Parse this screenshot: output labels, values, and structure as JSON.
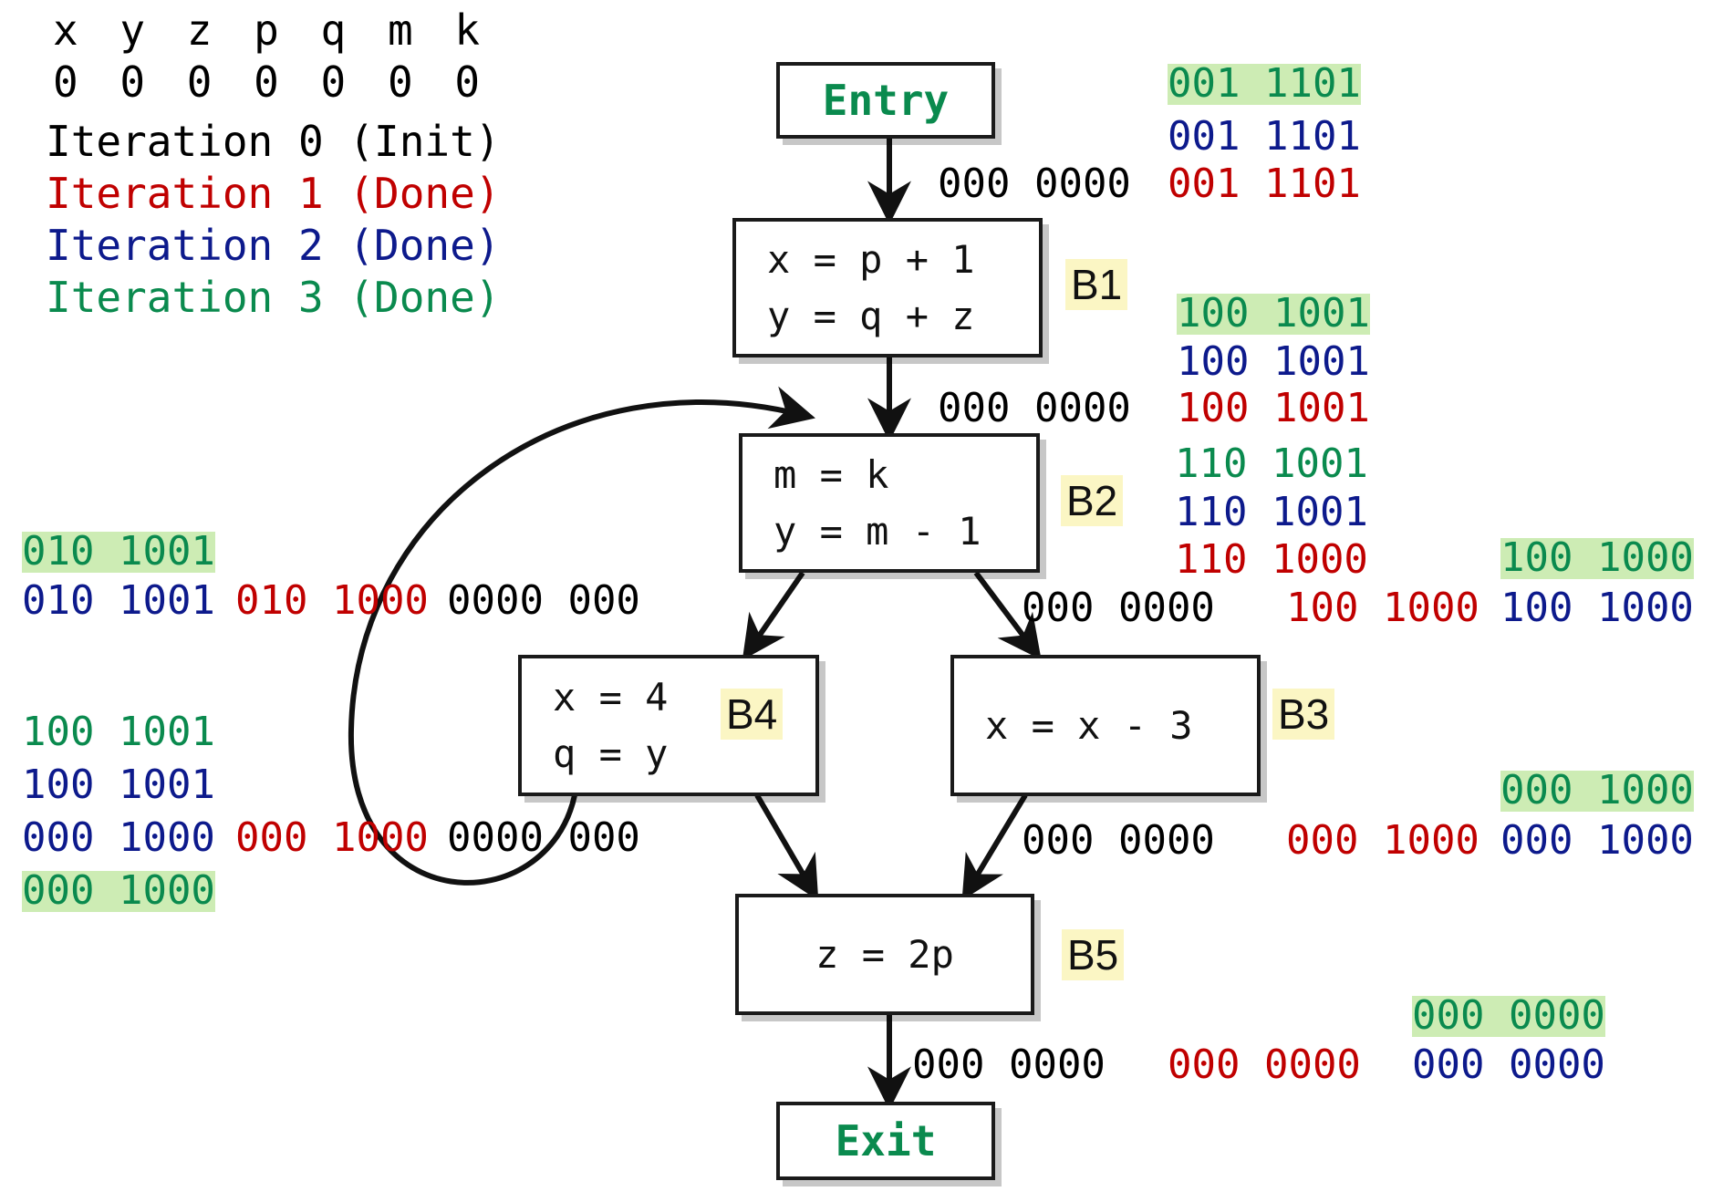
{
  "legend": {
    "variables": "x y z p q m k",
    "initial_bits": "0 0 0 0 0 0 0",
    "iterations": [
      {
        "label": "Iteration 0 (Init)",
        "color": "#000000"
      },
      {
        "label": "Iteration 1 (Done)",
        "color": "#c00000"
      },
      {
        "label": "Iteration 2 (Done)",
        "color": "#0d1a8c"
      },
      {
        "label": "Iteration 3 (Done)",
        "color": "#0a8a4e"
      }
    ]
  },
  "cfg": {
    "entry": {
      "label": "Entry"
    },
    "exit": {
      "label": "Exit"
    },
    "b1": {
      "name": "B1",
      "lines": [
        "x = p + 1",
        "y = q + z"
      ]
    },
    "b2": {
      "name": "B2",
      "lines": [
        "m = k",
        "y = m - 1"
      ]
    },
    "b3": {
      "name": "B3",
      "lines": [
        "x = x - 3"
      ]
    },
    "b4": {
      "name": "B4",
      "lines": [
        "x = 4",
        "q = y"
      ]
    },
    "b5": {
      "name": "B5",
      "lines": [
        "z = 2p"
      ]
    }
  },
  "dataflow": {
    "entry_out": {
      "green": "001 1101",
      "blue": "001 1101",
      "red": "001 1101"
    },
    "b1_in": {
      "black": "000 0000"
    },
    "b1_out": {
      "green": "100 1001",
      "blue": "100 1001",
      "red": "100 1001"
    },
    "b2_in": {
      "black": "000 0000"
    },
    "b2_out": {
      "green": "110 1001",
      "blue": "110 1001",
      "red": "110 1000"
    },
    "b4_in_left": {
      "green": "010 1001",
      "blue": "010 1001",
      "red": "010 1000",
      "black": "0000 000"
    },
    "b4_out_left": {
      "green_top": "100 1001",
      "blue_top": "100 1001",
      "blue": "000 1000",
      "red": "000 1000",
      "black": "0000 000",
      "green": "000 1000"
    },
    "b3_in_right": {
      "black": "000 0000",
      "red": "100 1000",
      "green": "100 1000",
      "blue": "100 1000"
    },
    "b3_out_right": {
      "black": "000 0000",
      "red": "000 1000",
      "green": "000 1000",
      "blue": "000 1000"
    },
    "b5_out": {
      "black": "000 0000",
      "red": "000 0000",
      "green": "000 0000",
      "blue": "000 0000"
    }
  }
}
